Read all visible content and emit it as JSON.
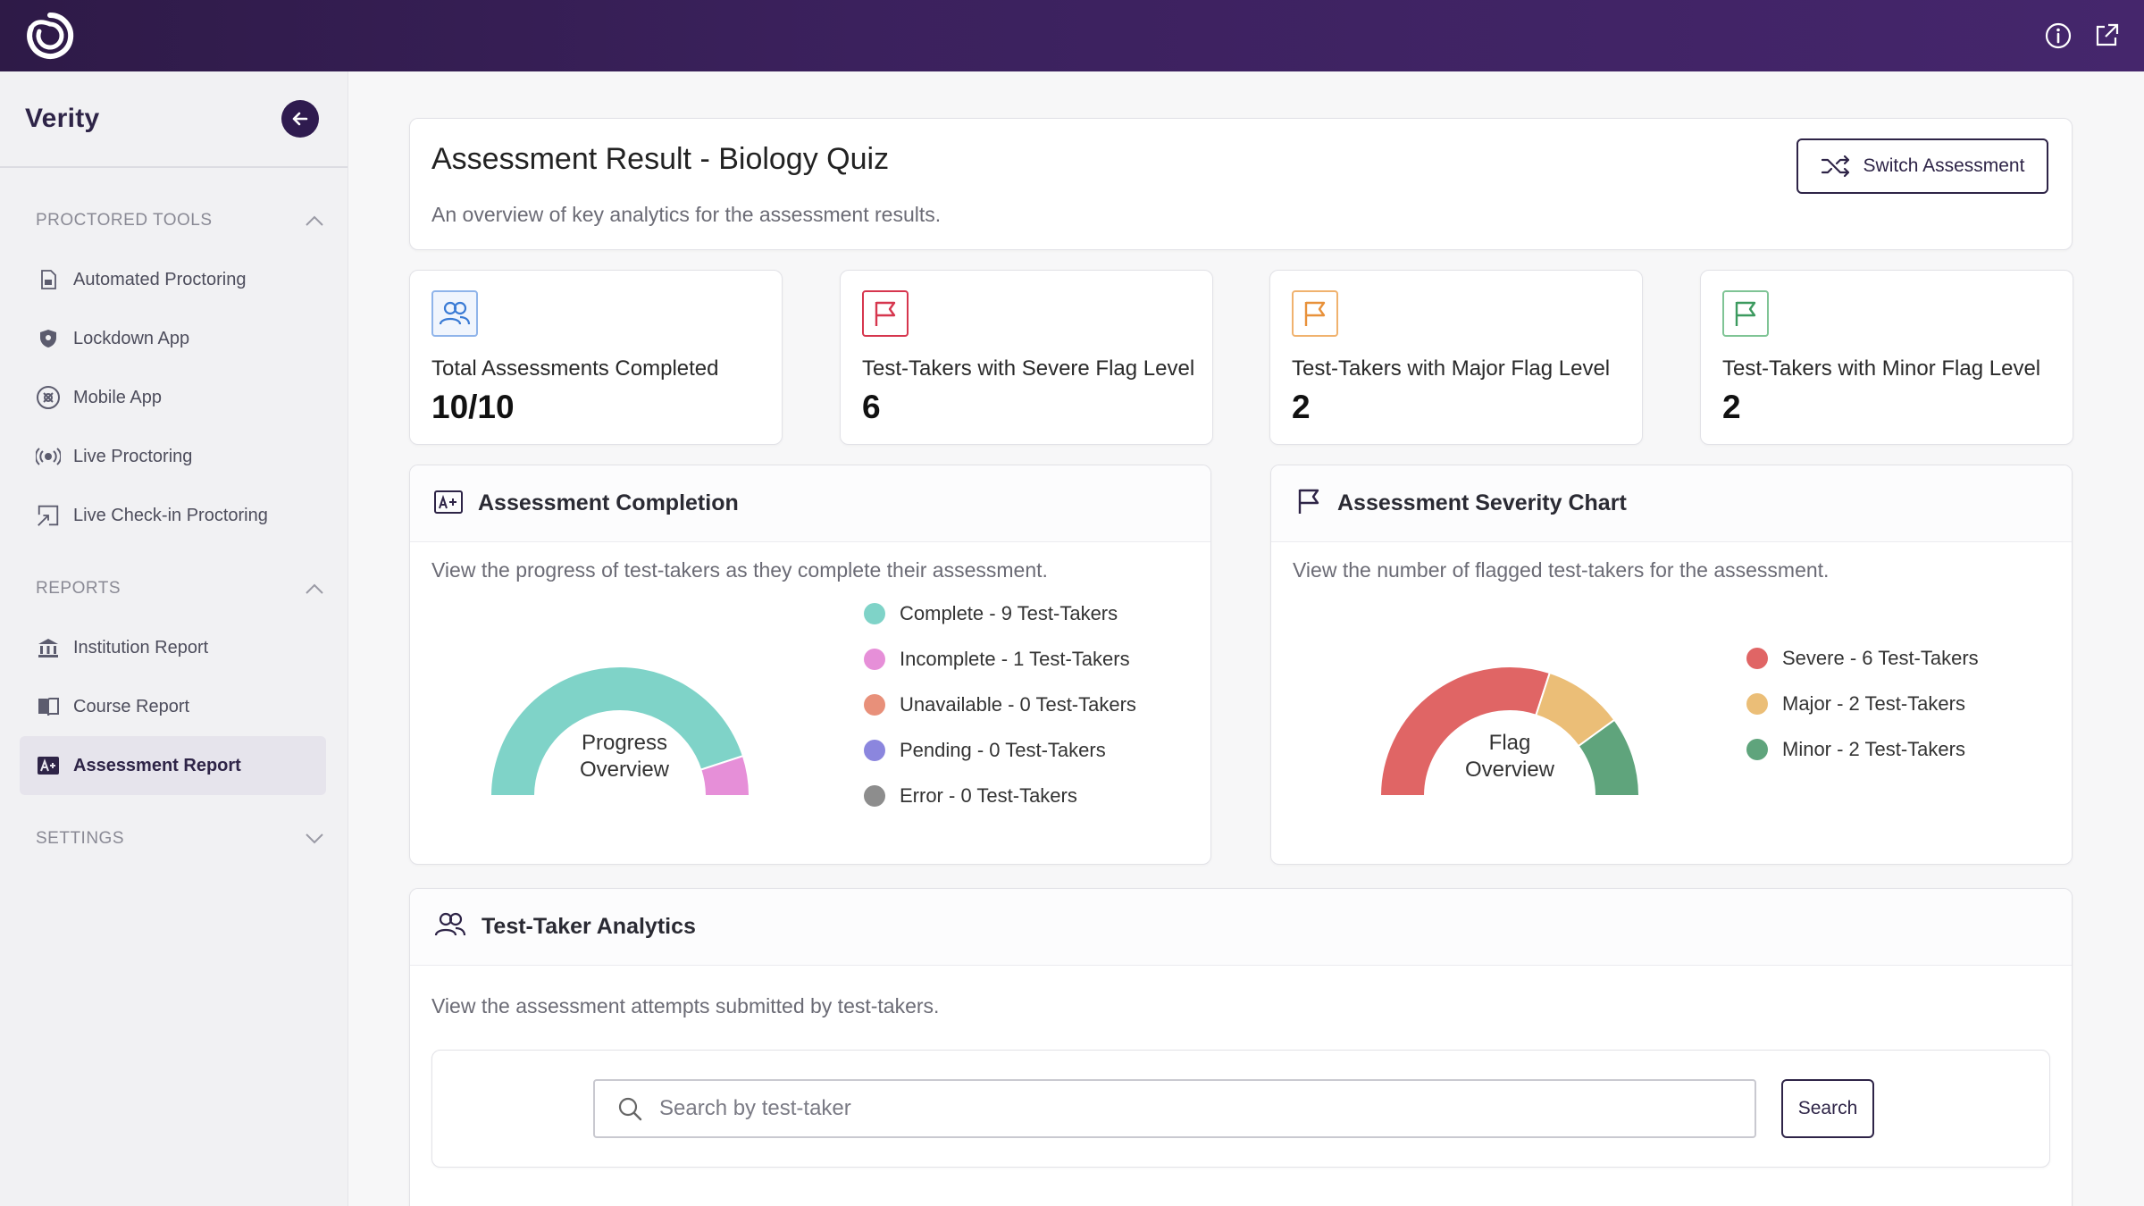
{
  "app": {
    "brand": "Verity",
    "logo_icon": "swirl-logo-icon",
    "top_icons": [
      "info-icon",
      "external-link-icon"
    ]
  },
  "sidebar": {
    "sections": [
      {
        "label": "PROCTORED TOOLS",
        "expanded": true,
        "items": [
          {
            "label": "Automated Proctoring",
            "icon": "document-scan-icon"
          },
          {
            "label": "Lockdown App",
            "icon": "shield-icon"
          },
          {
            "label": "Mobile App",
            "icon": "mobile-app-icon"
          },
          {
            "label": "Live Proctoring",
            "icon": "broadcast-icon"
          },
          {
            "label": "Live Check-in Proctoring",
            "icon": "check-in-icon"
          }
        ]
      },
      {
        "label": "REPORTS",
        "expanded": true,
        "items": [
          {
            "label": "Institution Report",
            "icon": "institution-icon"
          },
          {
            "label": "Course Report",
            "icon": "book-icon"
          },
          {
            "label": "Assessment Report",
            "icon": "assessment-icon",
            "active": true
          }
        ]
      },
      {
        "label": "SETTINGS",
        "expanded": false,
        "items": []
      }
    ]
  },
  "header": {
    "title": "Assessment Result - Biology Quiz",
    "subtitle": "An overview of key analytics for the assessment results.",
    "switch_label": "Switch Assessment"
  },
  "stats": [
    {
      "label": "Total Assessments Completed",
      "value": "10/10",
      "icon": "users-icon",
      "color": "#3a7bd5"
    },
    {
      "label": "Test-Takers with Severe Flag Level",
      "value": "6",
      "icon": "flag-icon",
      "color": "#d6364e"
    },
    {
      "label": "Test-Takers with Major Flag Level",
      "value": "2",
      "icon": "flag-icon",
      "color": "#e8913a"
    },
    {
      "label": "Test-Takers with Minor Flag Level",
      "value": "2",
      "icon": "flag-icon",
      "color": "#3c9a5f"
    }
  ],
  "completion": {
    "title": "Assessment Completion",
    "description": "View the progress of test-takers as they complete their assessment.",
    "gauge_label_1": "Progress",
    "gauge_label_2": "Overview",
    "legend": [
      {
        "label": "Complete - 9 Test-Takers",
        "color": "#7fd3c8",
        "count": 9
      },
      {
        "label": "Incomplete - 1 Test-Takers",
        "color": "#e68fd8",
        "count": 1
      },
      {
        "label": "Unavailable - 0 Test-Takers",
        "color": "#e8907a",
        "count": 0
      },
      {
        "label": "Pending - 0 Test-Takers",
        "color": "#8b86de",
        "count": 0
      },
      {
        "label": "Error - 0 Test-Takers",
        "color": "#8d8d8d",
        "count": 0
      }
    ]
  },
  "severity": {
    "title": "Assessment Severity Chart",
    "description": "View the number of flagged test-takers for the assessment.",
    "gauge_label_1": "Flag",
    "gauge_label_2": "Overview",
    "legend": [
      {
        "label": "Severe - 6 Test-Takers",
        "color": "#e06565",
        "count": 6
      },
      {
        "label": "Major - 2 Test-Takers",
        "color": "#ebbe77",
        "count": 2
      },
      {
        "label": "Minor - 2 Test-Takers",
        "color": "#5fa47c",
        "count": 2
      }
    ]
  },
  "analytics": {
    "title": "Test-Taker Analytics",
    "description": "View the assessment attempts submitted by test-takers.",
    "search_placeholder": "Search by test-taker",
    "search_value": "",
    "search_button": "Search"
  }
}
